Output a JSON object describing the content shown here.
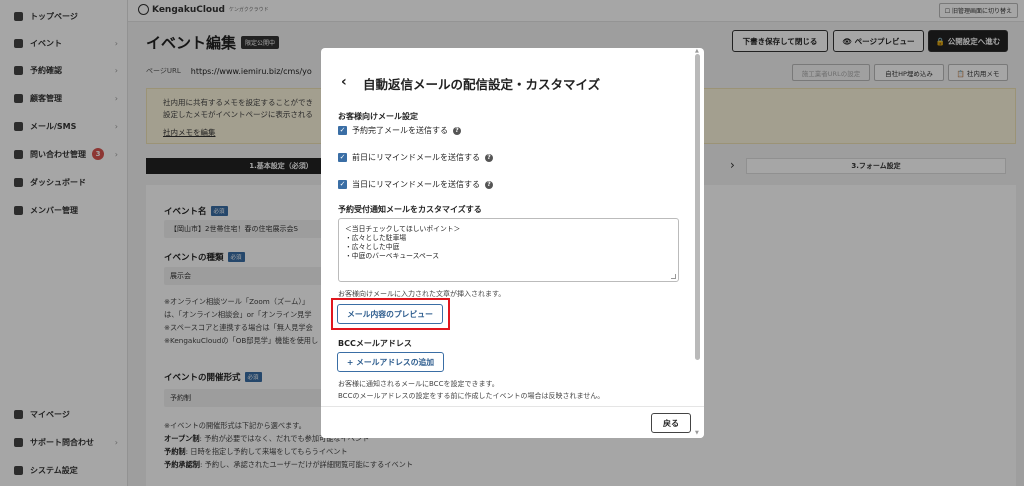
{
  "sidebar": {
    "items": [
      {
        "label": "トップページ",
        "icon": "home-icon",
        "chevron": ""
      },
      {
        "label": "イベント",
        "icon": "file-icon",
        "chevron": "›"
      },
      {
        "label": "予約確認",
        "icon": "calendar-icon",
        "chevron": "›"
      },
      {
        "label": "顧客管理",
        "icon": "users-icon",
        "chevron": "›"
      },
      {
        "label": "メール/SMS",
        "icon": "mail-icon",
        "chevron": "›"
      },
      {
        "label": "問い合わせ管理",
        "icon": "chat-icon",
        "chevron": "›",
        "badge": "3"
      },
      {
        "label": "ダッシュボード",
        "icon": "chart-icon",
        "chevron": ""
      },
      {
        "label": "メンバー管理",
        "icon": "grid-icon",
        "chevron": ""
      }
    ],
    "bottom_items": [
      {
        "label": "マイページ",
        "icon": "user-icon"
      },
      {
        "label": "サポート問合わせ",
        "icon": "help-icon",
        "chevron": "›"
      },
      {
        "label": "システム設定",
        "icon": "gear-icon"
      }
    ]
  },
  "topbar": {
    "logo": "KengakuCloud",
    "logo_tag": "ケンガククラウド",
    "admin_switch": "☐ 旧管理画面に切り替え"
  },
  "header": {
    "title": "イベント編集",
    "status": "限定公開中",
    "save_close": "下書き保存して閉じる",
    "page_preview": "👁 ページプレビュー",
    "publish_settings": "🔒 公開設定へ進む"
  },
  "url_row": {
    "label": "ページURL",
    "value": "https://www.iemiru.biz/cms/yo",
    "btn_partner": "施工業者URLの設定",
    "btn_embed": "自社HP埋め込み",
    "btn_memo": "📋 社内用メモ"
  },
  "memo": {
    "line1": "社内用に共有するメモを設定することができ",
    "line2": "設定したメモがイベントページに表示される",
    "edit_link": "社内メモを編集"
  },
  "steps": {
    "step1": "1.基本設定（必須）",
    "arrow": "›",
    "step3": "3.フォーム設定"
  },
  "form": {
    "event_name_label": "イベント名",
    "required": "必須",
    "event_name_value": "【岡山市】2世帯住宅！春の住宅展示会S",
    "event_type_label": "イベントの種類",
    "event_type_value": "展示会",
    "notes": [
      "※オンライン相談ツール「Zoom（ズーム）」",
      "は、「オンライン相談会」or「オンライン見学",
      "※スペースコアと連携する場合は「無人見学会",
      "※KengakuCloudの「OB邸見学」機能を使用し"
    ],
    "format_label": "イベントの開催形式",
    "format_value": "予約制",
    "format_notes": {
      "intro": "※イベントの開催形式は下記から選べます。",
      "open_key": "オープン制",
      "open_desc": ": 予約が必要ではなく、だれでも参加可能なイベント",
      "res_key": "予約制",
      "res_desc": ": 日時を指定し予約して来場をしてもらうイベント",
      "approve_key": "予約承認制",
      "approve_desc": ": 予約し、承認されたユーザーだけが詳細閲覧可能にするイベント"
    }
  },
  "modal": {
    "back": "‹",
    "title": "自動返信メールの配信設定・カスタマイズ",
    "customer_section": "お客様向けメール設定",
    "checkboxes": [
      {
        "label": "予約完了メールを送信する",
        "checked": true
      },
      {
        "label": "前日にリマインドメールを送信する",
        "checked": true
      },
      {
        "label": "当日にリマインドメールを送信する",
        "checked": true
      }
    ],
    "check_mark": "✓",
    "help_mark": "?",
    "customize_section": "予約受付通知メールをカスタマイズする",
    "textarea_lines": [
      "＜当日チェックしてほしいポイント＞",
      "・広々とした駐車場",
      "・広々とした中庭",
      "・中庭のバーベキュースペース"
    ],
    "textarea_hint": "お客様向けメールに入力された文章が挿入されます。",
    "preview_button": "メール内容のプレビュー",
    "bcc_section": "BCCメールアドレス",
    "add_address_button": "+ メールアドレスの追加",
    "bcc_hint1": "お客様に通知されるメールにBCCを設定できます。",
    "bcc_hint2": "BCCのメールアドレスの設定をする前に作成したイベントの場合は反映されません。",
    "return_button": "戻る",
    "scroll_up": "▲",
    "scroll_down": "▼"
  },
  "colors": {
    "accent": "#3a6ea5",
    "highlight": "#e0161e",
    "overlay": "rgba(0,0,0,0.35)"
  }
}
